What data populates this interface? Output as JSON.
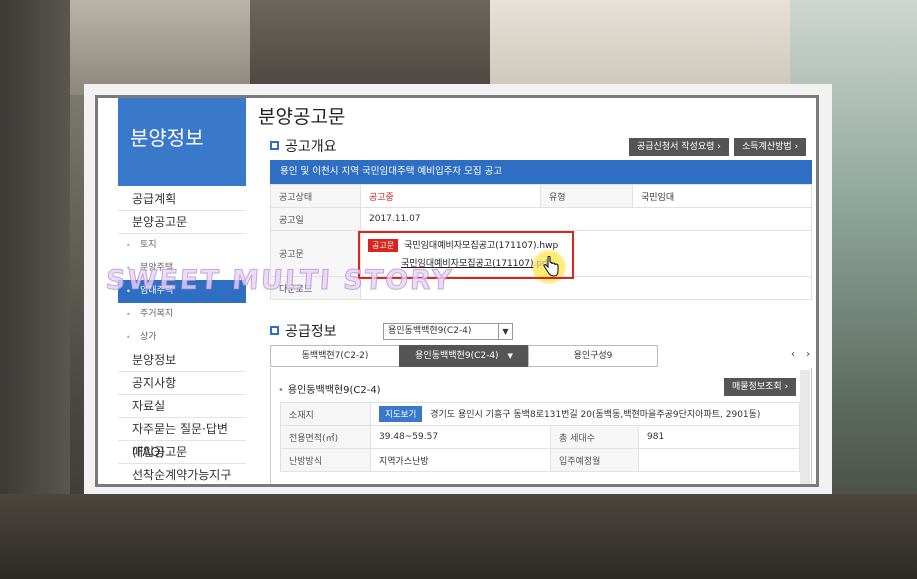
{
  "sidebar": {
    "heading": "분양정보",
    "items": [
      {
        "label": "공급계획"
      },
      {
        "label": "분양공고문"
      }
    ],
    "sub_items": [
      {
        "label": "토지",
        "active": false
      },
      {
        "label": "분양주택",
        "active": false
      },
      {
        "label": "임대주택",
        "active": true
      },
      {
        "label": "주거복지",
        "active": false
      },
      {
        "label": "상가",
        "active": false
      }
    ],
    "items_after": [
      {
        "label": "분양정보"
      },
      {
        "label": "공지사항"
      },
      {
        "label": "자료실"
      },
      {
        "label": "자주묻는 질문·답변(FAQ)"
      },
      {
        "label": "매입공고문"
      },
      {
        "label": "선착순계약가능지구"
      }
    ]
  },
  "page_title": "분양공고문",
  "overview": {
    "section_title": "공고개요",
    "btn_guide": "공급신청서 작성요령",
    "btn_income": "소득계산방법",
    "notice_title": "용인 및 이천시 지역 국민임대주택 예비입주자 모집 공고",
    "rows": {
      "status_label": "공고상태",
      "status_value": "공고중",
      "type_label": "유형",
      "type_value": "국민임대",
      "date_label": "공고일",
      "date_value": "2017.11.07",
      "doc_label": "공고문",
      "doc_badge": "공고문",
      "file_hwp": "국민임대예비자모집공고(171107).hwp",
      "file_pdf_name": "국민임대예비자모집공고(171107)",
      "file_pdf_ext": ".pdf",
      "download_label": "다운로드"
    }
  },
  "watermark": "SWEET MULTI STORY",
  "supply": {
    "section_title": "공급정보",
    "select_value": "용인동백백현9(C2-4)",
    "tabs": [
      {
        "label": "동백백현7(C2-2)",
        "active": false
      },
      {
        "label": "용인동백백현9(C2-4)",
        "active": true
      },
      {
        "label": "용인구성9",
        "active": false
      }
    ],
    "tab_nav": "‹ ›",
    "complex_title": "용인동백백현9(C2-4)",
    "btn_sales_info": "매물정보조회",
    "rows": {
      "location_label": "소재지",
      "map_btn": "지도보기",
      "location_value": "경기도 용인시 기흥구 동백8로131번길 20(동백동,백현마을주공9단지아파트, 2901동)",
      "area_label": "전용면적(㎡)",
      "area_value": "39.48~59.57",
      "households_label": "총 세대수",
      "households_value": "981",
      "heating_label": "난방방식",
      "heating_value": "지역가스난방",
      "move_in_label": "입주예정월",
      "move_in_value": ""
    }
  }
}
